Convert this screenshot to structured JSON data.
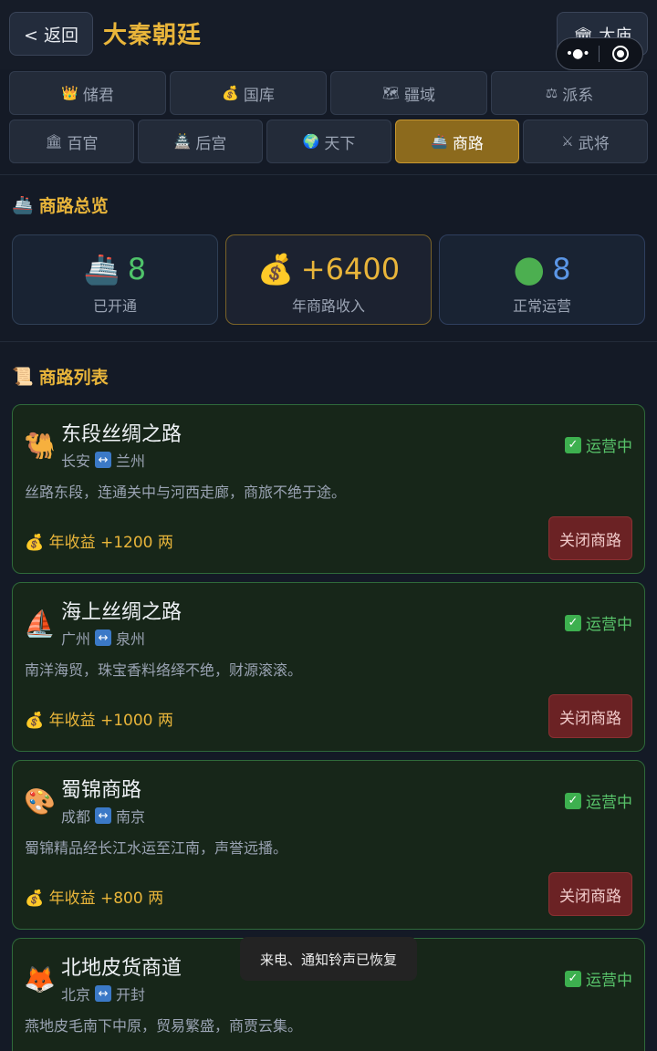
{
  "header": {
    "back_label": "< 返回",
    "title": "大秦朝廷",
    "temple_label": "🏛 太庙"
  },
  "tabs": [
    {
      "icon": "👑",
      "label": "储君",
      "active": false
    },
    {
      "icon": "💰",
      "label": "国库",
      "active": false
    },
    {
      "icon": "🗺",
      "label": "疆域",
      "active": false
    },
    {
      "icon": "⚖",
      "label": "派系",
      "active": false
    },
    {
      "icon": "🏛",
      "label": "百官",
      "active": false
    },
    {
      "icon": "🏯",
      "label": "后宫",
      "active": false
    },
    {
      "icon": "🌍",
      "label": "天下",
      "active": false
    },
    {
      "icon": "🚢",
      "label": "商路",
      "active": true
    },
    {
      "icon": "⚔",
      "label": "武将",
      "active": false
    }
  ],
  "overview": {
    "icon": "🚢",
    "title": "商路总览",
    "stats": [
      {
        "icon": "🚢",
        "value": "8",
        "label": "已开通",
        "color": "#4fc36a"
      },
      {
        "icon": "💰",
        "value": "+6400",
        "label": "年商路收入",
        "color": "#e9b53a"
      },
      {
        "icon": "●",
        "value": "8",
        "label": "正常运营",
        "color": "#5b96e6"
      }
    ]
  },
  "routes_section": {
    "icon": "📜",
    "title": "商路列表"
  },
  "routes": [
    {
      "icon": "🐫",
      "name": "东段丝绸之路",
      "from": "长安",
      "to": "兰州",
      "status": "运营中",
      "desc": "丝路东段，连通关中与河西走廊，商旅不绝于途。",
      "income": "💰 年收益 +1200 两",
      "button": "关闭商路"
    },
    {
      "icon": "⛵",
      "name": "海上丝绸之路",
      "from": "广州",
      "to": "泉州",
      "status": "运营中",
      "desc": "南洋海贸，珠宝香料络绎不绝，财源滚滚。",
      "income": "💰 年收益 +1000 两",
      "button": "关闭商路"
    },
    {
      "icon": "🎨",
      "name": "蜀锦商路",
      "from": "成都",
      "to": "南京",
      "status": "运营中",
      "desc": "蜀锦精品经长江水运至江南，声誉远播。",
      "income": "💰 年收益 +800 两",
      "button": "关闭商路"
    },
    {
      "icon": "🦊",
      "name": "北地皮货商道",
      "from": "北京",
      "to": "开封",
      "status": "运营中",
      "desc": "燕地皮毛南下中原，贸易繁盛，商贾云集。",
      "income": "",
      "button": ""
    }
  ],
  "toast": "来电、通知铃声已恢复"
}
